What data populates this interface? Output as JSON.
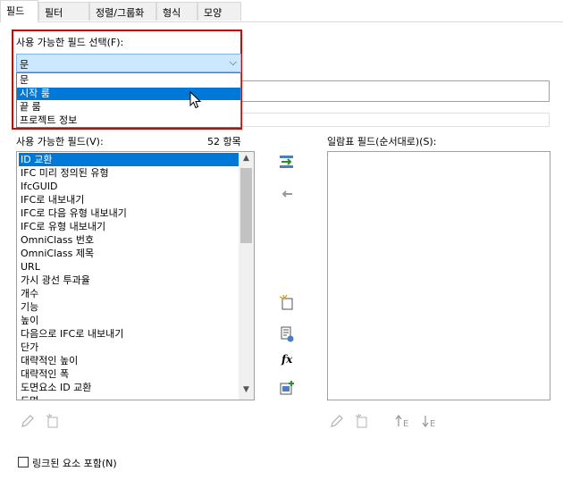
{
  "tabs": [
    {
      "label": "필드"
    },
    {
      "label": "필터"
    },
    {
      "label": "정렬/그룹화"
    },
    {
      "label": "형식"
    },
    {
      "label": "모양"
    }
  ],
  "select_field": {
    "label": "사용 가능한 필드 선택(F):",
    "value": "문",
    "options": [
      "문",
      "시작 룸",
      "끝 룸",
      "프로젝트 정보"
    ],
    "highlighted_index": 1
  },
  "available": {
    "label": "사용 가능한 필드(V):",
    "count": "52 항목",
    "items": [
      "ID 교환",
      "IFC 미리 정의된 유형",
      "IfcGUID",
      "IFC로 내보내기",
      "IFC로 다음 유형 내보내기",
      "IFC로 유형 내보내기",
      "OmniClass 번호",
      "OmniClass 제목",
      "URL",
      "가시 광선 투과율",
      "개수",
      "기능",
      "높이",
      "다음으로 IFC로 내보내기",
      "단가",
      "대략적인 높이",
      "대략적인 폭",
      "도면요소 ID 교환",
      "도면"
    ],
    "selected_index": 0
  },
  "schedule": {
    "label": "일람표 필드(순서대로)(S):"
  },
  "include_linked": {
    "label": "링크된 요소 포함(N)",
    "checked": false
  },
  "colors": {
    "highlight": "#0078d7",
    "red_box": "#e00000",
    "combo_bg": "#cce8ff"
  }
}
